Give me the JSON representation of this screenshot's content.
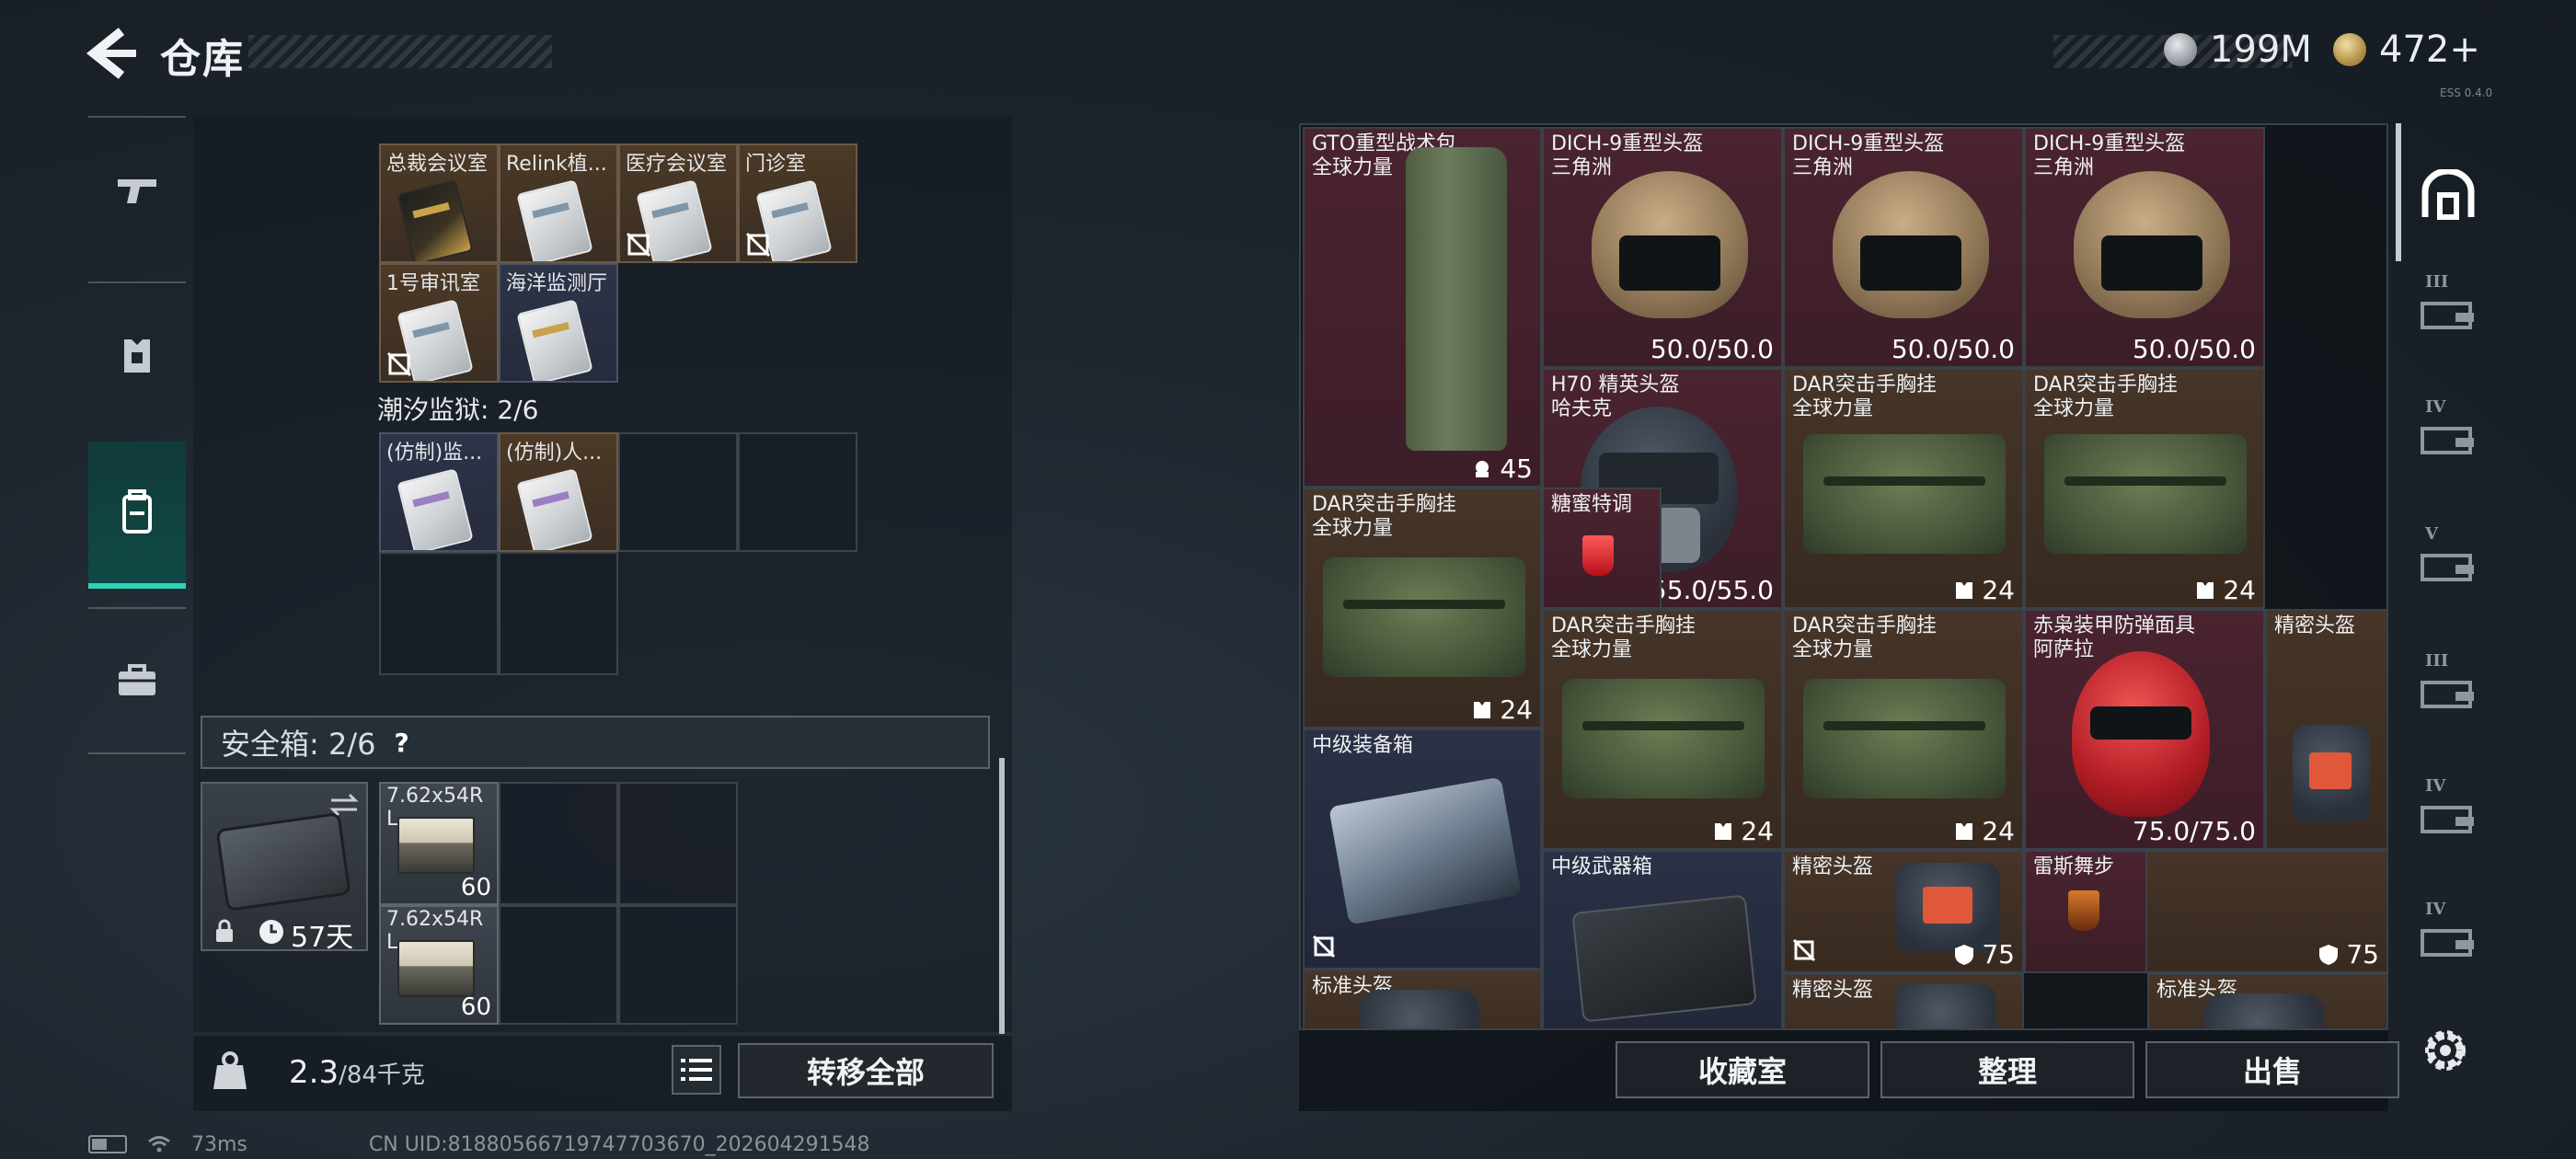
{
  "header": {
    "title": "仓库",
    "currency_silver": "199M",
    "currency_gold": "472+",
    "version": "ESS 0.4.0"
  },
  "left_tabs": [
    {
      "icon": "gun-icon"
    },
    {
      "icon": "armor-icon"
    },
    {
      "icon": "backpack-icon"
    },
    {
      "icon": "briefcase-icon"
    }
  ],
  "left_panel": {
    "keycards_row1": [
      {
        "label": "总裁会议室",
        "style": "black"
      },
      {
        "label": "Relink植...",
        "style": "white"
      },
      {
        "label": "医疗会议室",
        "style": "white"
      },
      {
        "label": "门诊室",
        "style": "white"
      }
    ],
    "keycards_row2": [
      {
        "label": "1号审讯室",
        "style": "white"
      },
      {
        "label": "海洋监测厅",
        "style": "white"
      }
    ],
    "prison_section_title": "潮汐监狱: 2/6",
    "prison_cards": [
      {
        "label": "(仿制)监...",
        "style": "purple"
      },
      {
        "label": "(仿制)人...",
        "style": "purple"
      }
    ],
    "safe_title": "安全箱: 2/6",
    "safe_help": "?",
    "safe_days": "57天",
    "ammo": [
      {
        "label": "7.62x54R",
        "label2": "L",
        "count": "60"
      },
      {
        "label": "7.62x54R",
        "label2": "L",
        "count": "60"
      }
    ]
  },
  "bottom_left": {
    "weight_value": "2.3",
    "weight_max": "/84千克",
    "transfer_all": "转移全部"
  },
  "status": {
    "ping": "73ms",
    "uid": "CN UID:81880566719747703670_202604291548"
  },
  "stash": {
    "items": [
      {
        "name": "GTO重型战术包",
        "sub": "全球力量",
        "value": "45"
      },
      {
        "name": "DICH-9重型头盔",
        "sub": "三角洲",
        "value": "50.0/50.0"
      },
      {
        "name": "DICH-9重型头盔",
        "sub": "三角洲",
        "value": "50.0/50.0"
      },
      {
        "name": "DICH-9重型头盔",
        "sub": "三角洲",
        "value": "50.0/50.0"
      },
      {
        "name": "H70 精英头盔",
        "sub": "哈夫克",
        "value": "55.0/55.0"
      },
      {
        "name": "DAR突击手胸挂",
        "sub": "全球力量",
        "value": "24"
      },
      {
        "name": "DAR突击手胸挂",
        "sub": "全球力量",
        "value": "24"
      },
      {
        "name": "DAR突击手胸挂",
        "sub": "全球力量",
        "value": "24"
      },
      {
        "name": "糖蜜特调",
        "sub": "",
        "value": ""
      },
      {
        "name": "DAR突击手胸挂",
        "sub": "全球力量",
        "value": "24"
      },
      {
        "name": "DAR突击手胸挂",
        "sub": "全球力量",
        "value": "24"
      },
      {
        "name": "赤枭装甲防弹面具",
        "sub": "阿萨拉",
        "value": "75.0/75.0"
      },
      {
        "name": "精密头盔",
        "sub": "",
        "value": ""
      },
      {
        "name": "中级装备箱",
        "sub": "",
        "value": ""
      },
      {
        "name": "中级武器箱",
        "sub": "",
        "value": ""
      },
      {
        "name": "精密头盔",
        "sub": "",
        "value": "75"
      },
      {
        "name": "雷斯舞步",
        "sub": "",
        "value": "75"
      },
      {
        "name": "标准头盔",
        "sub": "",
        "value": ""
      },
      {
        "name": "精密头盔",
        "sub": "",
        "value": ""
      },
      {
        "name": "标准头盔",
        "sub": "",
        "value": ""
      }
    ],
    "buttons": {
      "collection": "收藏室",
      "sort": "整理",
      "sell": "出售"
    }
  },
  "right_tabs": [
    {
      "icon": "main-stash-icon",
      "level": ""
    },
    {
      "icon": "stash-tab-icon",
      "level": "III"
    },
    {
      "icon": "stash-tab-icon",
      "level": "IV"
    },
    {
      "icon": "stash-tab-icon",
      "level": "V"
    },
    {
      "icon": "stash-tab-icon",
      "level": "III"
    },
    {
      "icon": "stash-tab-icon",
      "level": "IV"
    },
    {
      "icon": "stash-tab-icon",
      "level": "IV"
    }
  ],
  "colors": {
    "accent_teal": "#31d2b9",
    "rarity_red": "#4a2430",
    "rarity_gold": "#463528",
    "rarity_blue": "#2b3146"
  }
}
